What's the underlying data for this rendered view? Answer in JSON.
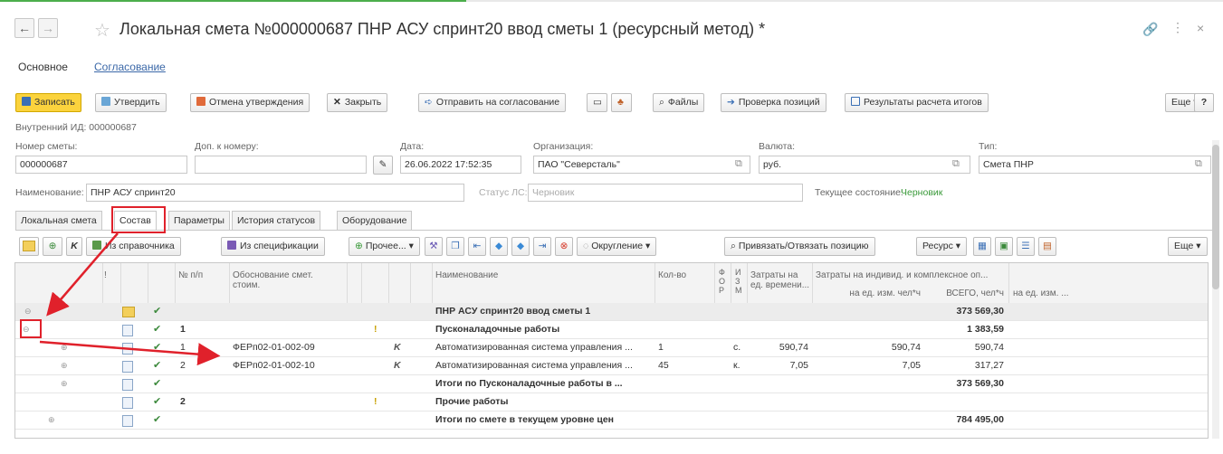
{
  "window": {
    "title": "Локальная смета №000000687 ПНР АСУ спринт20 ввод сметы 1 (ресурсный метод) *"
  },
  "form_tabs": [
    {
      "label": "Основное"
    },
    {
      "label": "Согласование"
    }
  ],
  "toolbar": {
    "save": "Записать",
    "approve": "Утвердить",
    "cancel_approve": "Отмена утверждения",
    "close": "Закрыть",
    "send": "Отправить на согласование",
    "files": "Файлы",
    "check": "Проверка позиций",
    "results": "Результаты расчета итогов",
    "more": "Еще",
    "help": "?"
  },
  "internal_id": "Внутренний ИД: 000000687",
  "fields": {
    "number_label": "Номер сметы:",
    "number_value": "000000687",
    "add_label": "Доп. к номеру:",
    "add_value": "",
    "date_label": "Дата:",
    "date_value": "26.06.2022 17:52:35",
    "org_label": "Организация:",
    "org_value": "ПАО \"Северсталь\"",
    "currency_label": "Валюта:",
    "currency_value": "руб.",
    "type_label": "Тип:",
    "type_value": "Смета ПНР",
    "name_label": "Наименование:",
    "name_value": "ПНР АСУ спринт20",
    "status_label": "Статус ЛС:",
    "status_value": "Черновик",
    "state_label": "Текущее состояние:",
    "state_value": "Черновик"
  },
  "inner_tabs": [
    {
      "label": "Локальная смета"
    },
    {
      "label": "Состав"
    },
    {
      "label": "Параметры"
    },
    {
      "label": "История статусов"
    },
    {
      "label": "Оборудование"
    }
  ],
  "grid_toolbar": {
    "k": "K",
    "from_ref": "Из справочника",
    "from_spec": "Из спецификации",
    "other": "Прочее...",
    "rounding": "Округление",
    "bind": "Привязать/Отвязать позицию",
    "resource": "Ресурс",
    "more": "Еще"
  },
  "columns": {
    "excl": "!",
    "num": "№ п/п",
    "basis": "Обоснование смет. стоим.",
    "name": "Наименование",
    "qty": "Кол-во",
    "f": "Ф О Р",
    "i": "И З М",
    "time": "Затраты на ед. времени...",
    "costs_group": "Затраты на индивид. и комплексное оп...",
    "per_unit": "на ед. изм. чел*ч",
    "total": "ВСЕГО, чел*ч",
    "per_unit2": "на ед. изм. ..."
  },
  "rows": [
    {
      "num": "",
      "basis": "",
      "name": "ПНР АСУ спринт20 ввод сметы 1",
      "qty": "",
      "i": "",
      "time": "",
      "per_unit": "",
      "total": "373 569,30",
      "excl": "",
      "k": ""
    },
    {
      "num": "1",
      "basis": "",
      "name": "Пусконаладочные работы",
      "qty": "",
      "i": "",
      "time": "",
      "per_unit": "",
      "total": "1 383,59",
      "excl": "!",
      "k": ""
    },
    {
      "num": "1",
      "basis": "ФЕРп02-01-002-09",
      "name": "Автоматизированная система управления ...",
      "qty": "1",
      "i": "с.",
      "time": "590,74",
      "per_unit": "590,74",
      "total": "590,74",
      "excl": "",
      "k": "K"
    },
    {
      "num": "2",
      "basis": "ФЕРп02-01-002-10",
      "name": "Автоматизированная система управления ...",
      "qty": "45",
      "i": "к.",
      "time": "7,05",
      "per_unit": "7,05",
      "total": "317,27",
      "excl": "",
      "k": "K"
    },
    {
      "num": "",
      "basis": "",
      "name": "Итоги по Пусконаладочные работы в ...",
      "qty": "",
      "i": "",
      "time": "",
      "per_unit": "",
      "total": "373 569,30",
      "excl": "",
      "k": ""
    },
    {
      "num": "2",
      "basis": "",
      "name": "Прочие работы",
      "qty": "",
      "i": "",
      "time": "",
      "per_unit": "",
      "total": "",
      "excl": "!",
      "k": ""
    },
    {
      "num": "",
      "basis": "",
      "name": "Итоги по смете в текущем уровне цен",
      "qty": "",
      "i": "",
      "time": "",
      "per_unit": "",
      "total": "784 495,00",
      "excl": "",
      "k": ""
    }
  ],
  "colors": {
    "accent": "#fbd33d",
    "annotation": "#e0212b",
    "link": "#3b68a8"
  }
}
